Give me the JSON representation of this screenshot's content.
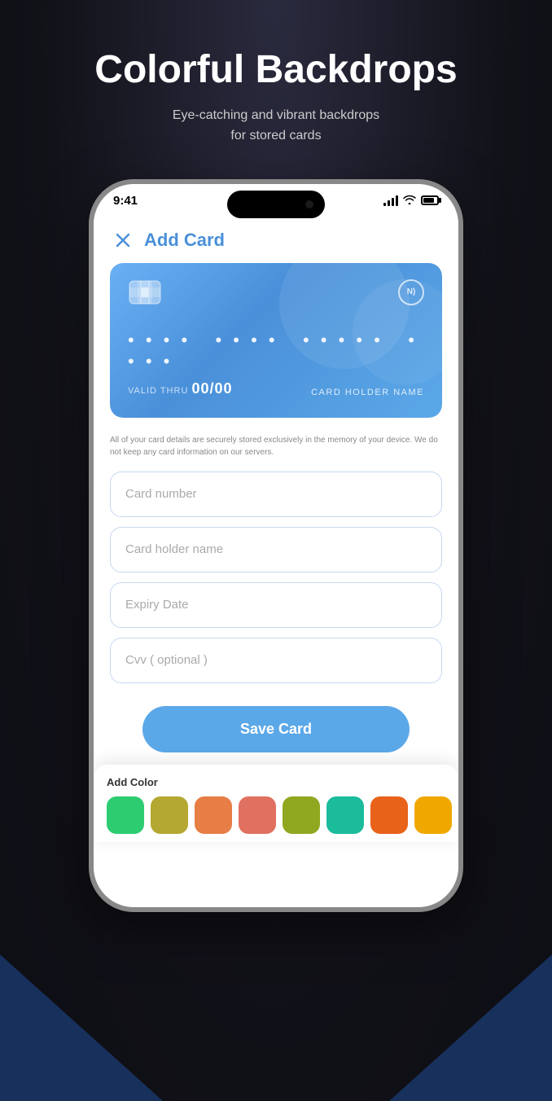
{
  "page": {
    "background": "#111118"
  },
  "header": {
    "title": "Colorful Backdrops",
    "subtitle": "Eye-catching and vibrant backdrops\nfor stored cards"
  },
  "phone": {
    "status_bar": {
      "time": "9:41"
    },
    "top_bar": {
      "close_icon": "×",
      "title": "Add Card"
    },
    "card": {
      "number_placeholder": "• • • •  • • • •  • • • • •  • • • •",
      "valid_thru_label": "VALID THRU",
      "valid_date": "00/00",
      "holder_name": "CARD HOLDER NAME",
      "nfc_label": "N)"
    },
    "security_note": "All of your card details are securely stored exclusively in the memory of your device. We do not keep any card information on our servers.",
    "form": {
      "card_number_placeholder": "Card number",
      "holder_name_placeholder": "Card holder name",
      "expiry_placeholder": "Expiry Date",
      "cvv_placeholder": "Cvv ( optional )"
    },
    "color_picker": {
      "label": "Add Color",
      "colors": [
        {
          "name": "green",
          "hex": "#2ecc71"
        },
        {
          "name": "olive",
          "hex": "#b5a832"
        },
        {
          "name": "orange",
          "hex": "#e67e45"
        },
        {
          "name": "salmon",
          "hex": "#e07060"
        },
        {
          "name": "yellow-green",
          "hex": "#8fa820"
        },
        {
          "name": "teal",
          "hex": "#1abc9c"
        },
        {
          "name": "orange2",
          "hex": "#e8621a"
        },
        {
          "name": "gold",
          "hex": "#f0a800"
        }
      ]
    },
    "save_button": {
      "label": "Save Card"
    }
  }
}
